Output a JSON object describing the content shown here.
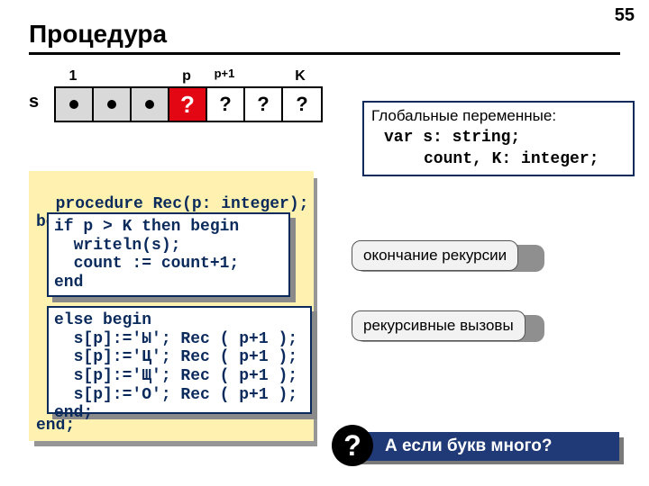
{
  "page_number": "55",
  "title": "Процедура",
  "array": {
    "label_s": "s",
    "col_labels": [
      "1",
      "",
      "",
      "p",
      "p+1",
      "",
      "K"
    ],
    "cells": [
      {
        "kind": "dot",
        "bg": "gray"
      },
      {
        "kind": "dot",
        "bg": "gray"
      },
      {
        "kind": "dot",
        "bg": "gray"
      },
      {
        "kind": "text",
        "text": "?",
        "bg": "red"
      },
      {
        "kind": "text",
        "text": "?",
        "bg": "white"
      },
      {
        "kind": "text",
        "text": "?",
        "bg": "white"
      },
      {
        "kind": "text",
        "text": "?",
        "bg": "white"
      }
    ]
  },
  "globals": {
    "header": "Глобальные переменные:",
    "line1": "var s: string;",
    "line2": "count, K: integer;"
  },
  "code": {
    "outer_top": "procedure Rec(p: integer);\nbegin",
    "outer_bottom": "end;",
    "box1": "if p > K then begin\n  writeln(s);\n  count := count+1;\nend",
    "box2": "else begin\n  s[p]:='Ы'; Rec ( p+1 );\n  s[p]:='Ц'; Rec ( p+1 );\n  s[p]:='Щ'; Rec ( p+1 );\n  s[p]:='О'; Rec ( p+1 );\nend;"
  },
  "callouts": {
    "c1": "окончание рекурсии",
    "c2": "рекурсивные вызовы"
  },
  "question": {
    "icon": "?",
    "text": "А если букв много?"
  }
}
